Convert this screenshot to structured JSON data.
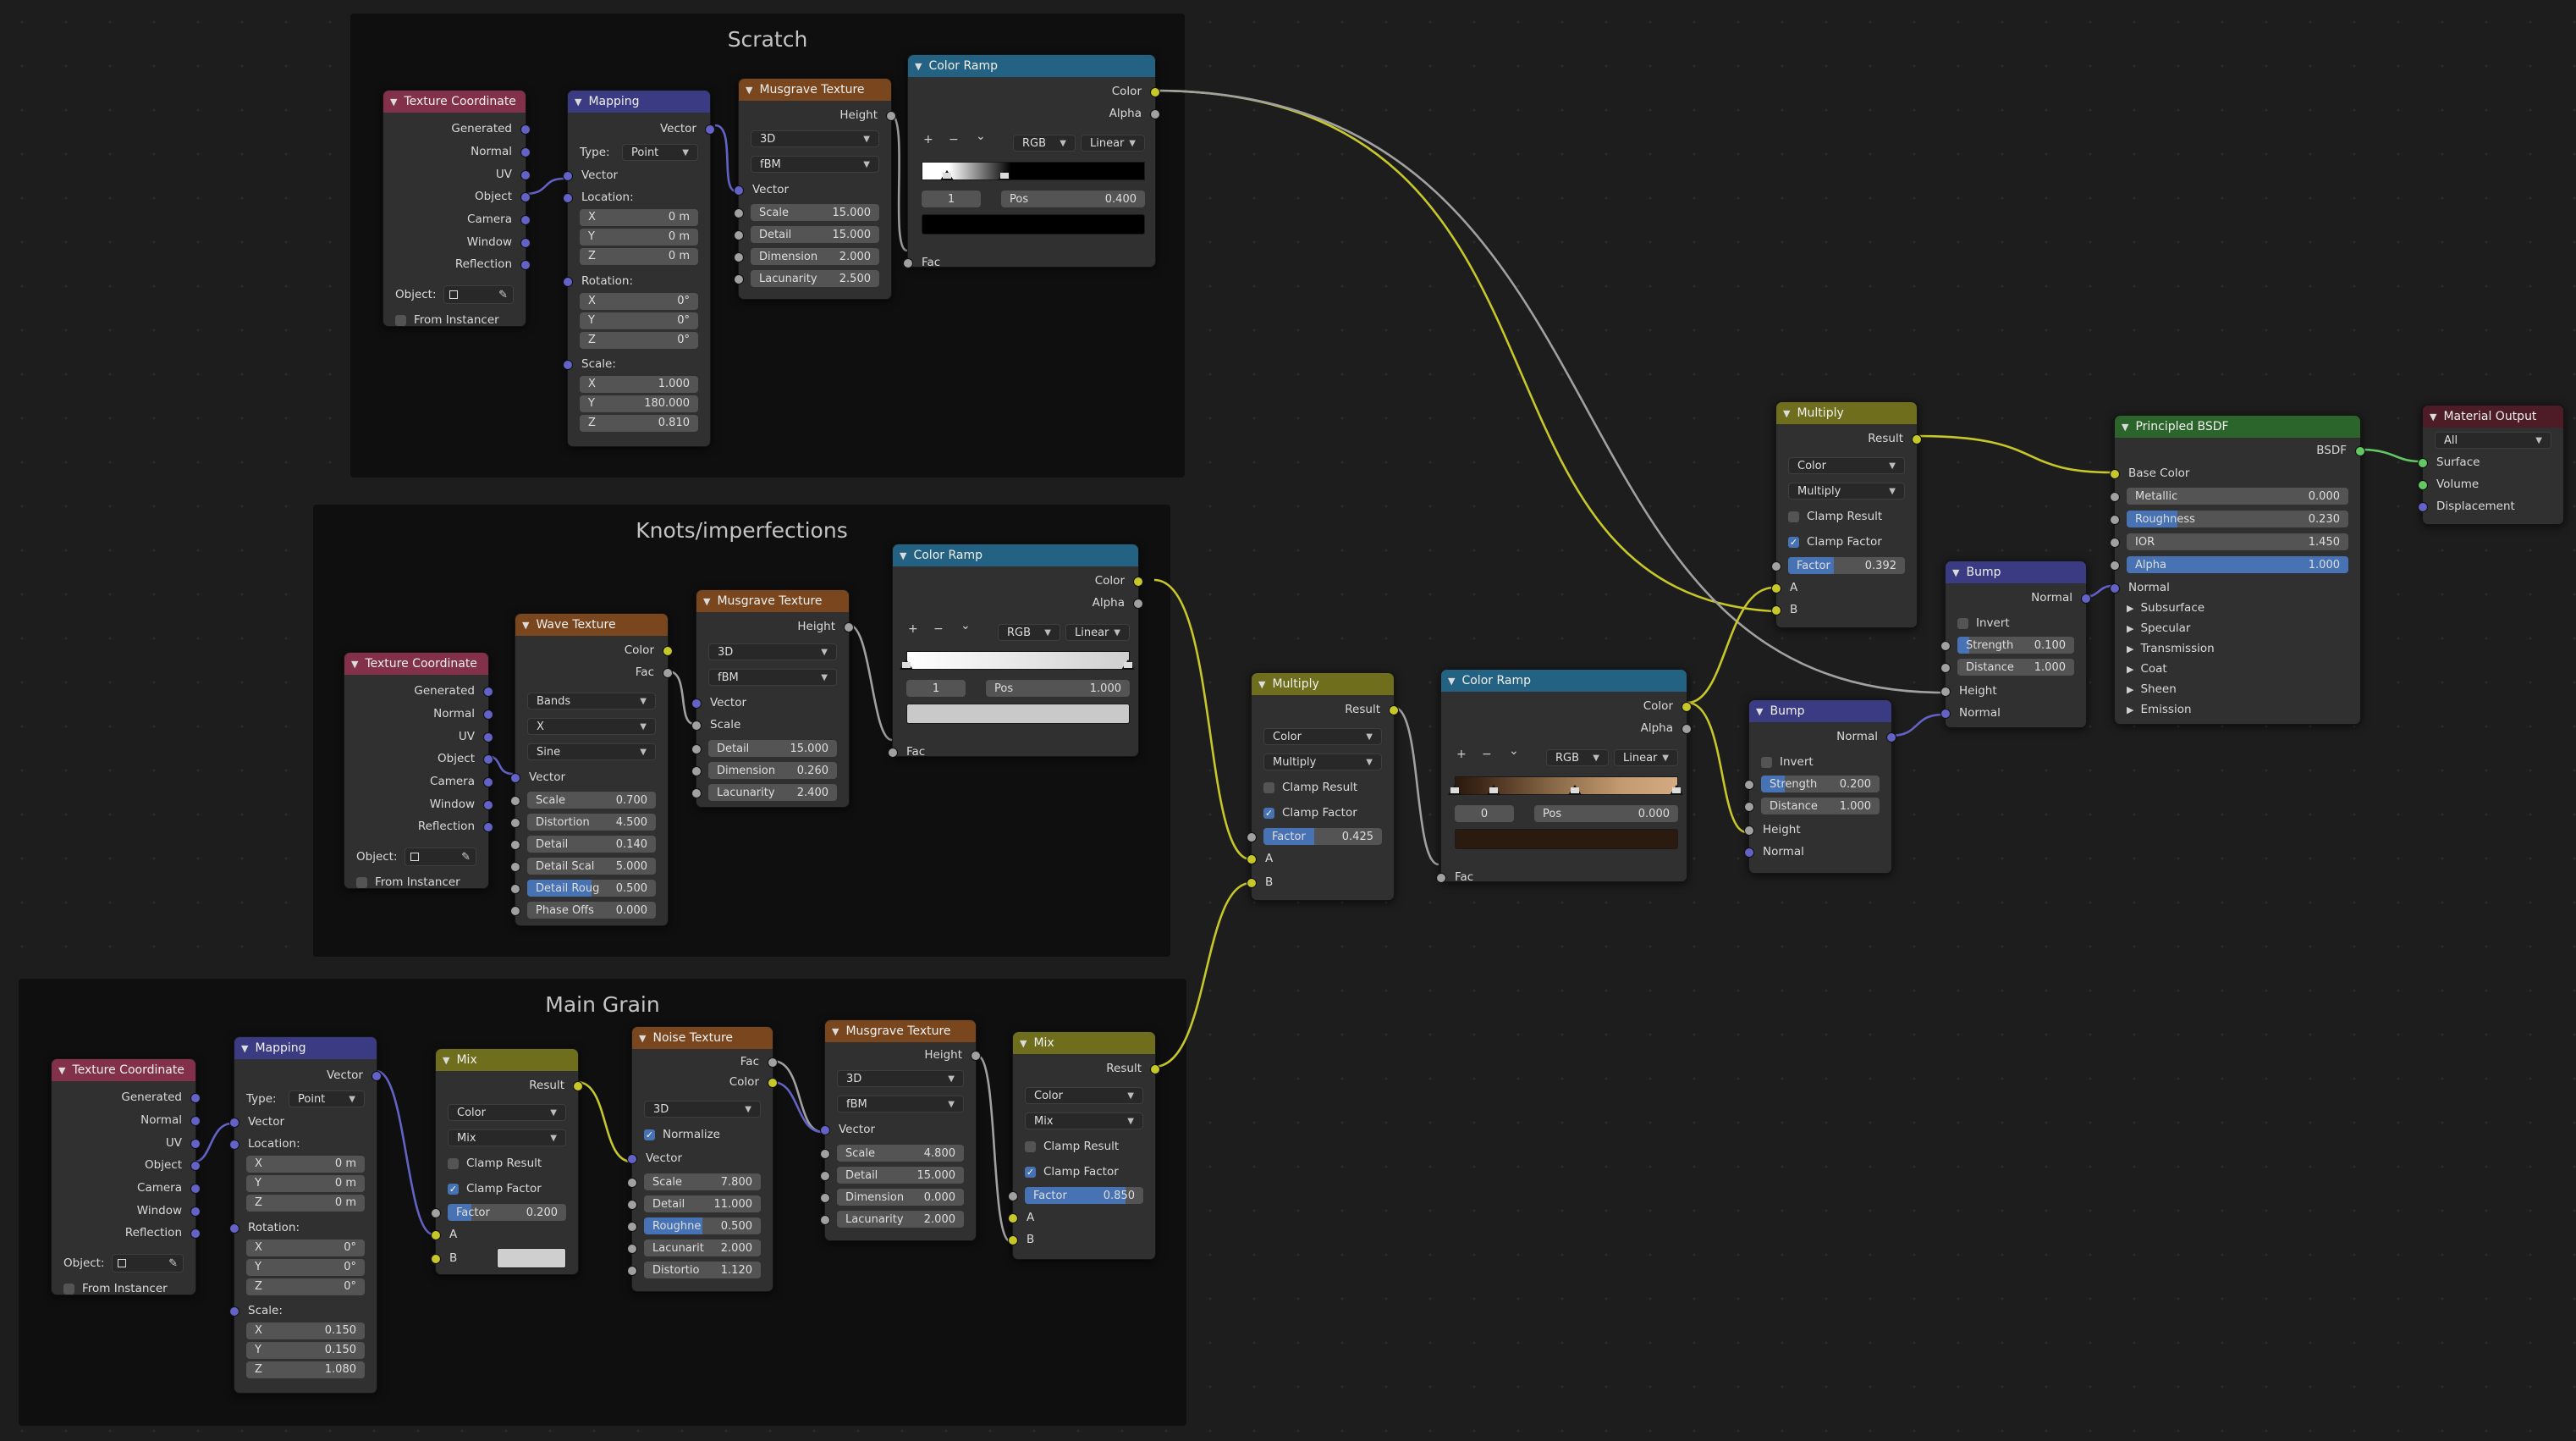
{
  "colors": {
    "accent": "#4772b3",
    "socket_vector": "#6363c7",
    "socket_float": "#a1a1a1",
    "socket_color": "#c7c729",
    "socket_shader": "#63c763",
    "header_input": "#83314a",
    "header_vector": "#3b3b83",
    "header_texture": "#79461d",
    "header_converter": "#246283",
    "header_color": "#6e6e1d",
    "header_shader": "#2b652b",
    "header_output": "#4d1c27"
  },
  "frames": {
    "scratch": "Scratch",
    "knots": "Knots/imperfections",
    "grain": "Main Grain"
  },
  "common": {
    "generated": "Generated",
    "normal": "Normal",
    "uv": "UV",
    "object": "Object",
    "camera": "Camera",
    "window": "Window",
    "reflection": "Reflection",
    "object_label": "Object:",
    "from_instancer": "From Instancer",
    "vector": "Vector",
    "type_label": "Type:",
    "point": "Point",
    "location": "Location:",
    "rotation": "Rotation:",
    "scale_label": "Scale:",
    "x": "X",
    "y": "Y",
    "z": "Z",
    "height": "Height",
    "d3": "3D",
    "fbm": "fBM",
    "scale": "Scale",
    "detail": "Detail",
    "dimension": "Dimension",
    "lacunarity": "Lacunarity",
    "color": "Color",
    "alpha": "Alpha",
    "fac": "Fac",
    "plus": "+",
    "minus": "−",
    "chev": "⌄",
    "rgb": "RGB",
    "linear": "Linear",
    "pos": "Pos",
    "result": "Result",
    "multiply": "Multiply",
    "mix": "Mix",
    "clamp_result": "Clamp Result",
    "clamp_factor": "Clamp Factor",
    "factor": "Factor",
    "a": "A",
    "b": "B",
    "invert": "Invert",
    "strength": "Strength",
    "distance": "Distance"
  },
  "scratch": {
    "tc_title": "Texture Coordinate",
    "map_title": "Mapping",
    "loc": [
      "0 m",
      "0 m",
      "0 m"
    ],
    "rot": [
      "0°",
      "0°",
      "0°"
    ],
    "scl": [
      "1.000",
      "180.000",
      "0.810"
    ],
    "mus_title": "Musgrave Texture",
    "mus": [
      "15.000",
      "15.000",
      "2.000",
      "2.500"
    ],
    "ramp_title": "Color Ramp",
    "ramp_index": "1",
    "ramp_pos": "0.400"
  },
  "knots": {
    "tc_title": "Texture Coordinate",
    "wave_title": "Wave Texture",
    "wave_type": "Bands",
    "wave_dir": "X",
    "wave_profile": "Sine",
    "wave_labels": [
      "Scale",
      "Distortion",
      "Detail",
      "Detail Scal",
      "Detail Roug",
      "Phase Offs"
    ],
    "wave_vals": [
      "0.700",
      "4.500",
      "0.140",
      "5.000",
      "0.500",
      "0.000"
    ],
    "mus_title": "Musgrave Texture",
    "mus_vals": [
      "15.000",
      "0.260",
      "2.400"
    ],
    "ramp_title": "Color Ramp",
    "ramp_index": "1",
    "ramp_pos": "1.000"
  },
  "grain": {
    "tc_title": "Texture Coordinate",
    "map_title": "Mapping",
    "loc": [
      "0 m",
      "0 m",
      "0 m"
    ],
    "rot": [
      "0°",
      "0°",
      "0°"
    ],
    "scl": [
      "0.150",
      "0.150",
      "1.080"
    ],
    "mix1_title": "Mix",
    "mix1_factor": "0.200",
    "noise_title": "Noise Texture",
    "normalize": "Normalize",
    "noise_labels": [
      "Scale",
      "Detail",
      "Roughne",
      "Lacunarit",
      "Distortio"
    ],
    "noise_vals": [
      "7.800",
      "11.000",
      "0.500",
      "2.000",
      "1.120"
    ],
    "mus_title": "Musgrave Texture",
    "mus_vals": [
      "4.800",
      "15.000",
      "0.000",
      "2.000"
    ],
    "mix2_title": "Mix",
    "mix2_factor": "0.850"
  },
  "mult1": {
    "title": "Multiply",
    "factor": "0.425"
  },
  "ramp3": {
    "title": "Color Ramp",
    "index": "0",
    "pos": "0.000"
  },
  "bump1": {
    "title": "Bump",
    "strength": "0.200",
    "distance": "1.000"
  },
  "mult2": {
    "title": "Multiply",
    "factor": "0.392"
  },
  "bump2": {
    "title": "Bump",
    "strength": "0.100",
    "distance": "1.000"
  },
  "bsdf": {
    "title": "Principled BSDF",
    "out": "BSDF",
    "base_color": "Base Color",
    "labels": [
      "Metallic",
      "Roughness",
      "IOR",
      "Alpha"
    ],
    "values": [
      "0.000",
      "0.230",
      "1.450",
      "1.000"
    ],
    "normal": "Normal",
    "panels": [
      "Subsurface",
      "Specular",
      "Transmission",
      "Coat",
      "Sheen",
      "Emission"
    ]
  },
  "matout": {
    "title": "Material Output",
    "target": "All",
    "surface": "Surface",
    "volume": "Volume",
    "displacement": "Displacement"
  }
}
